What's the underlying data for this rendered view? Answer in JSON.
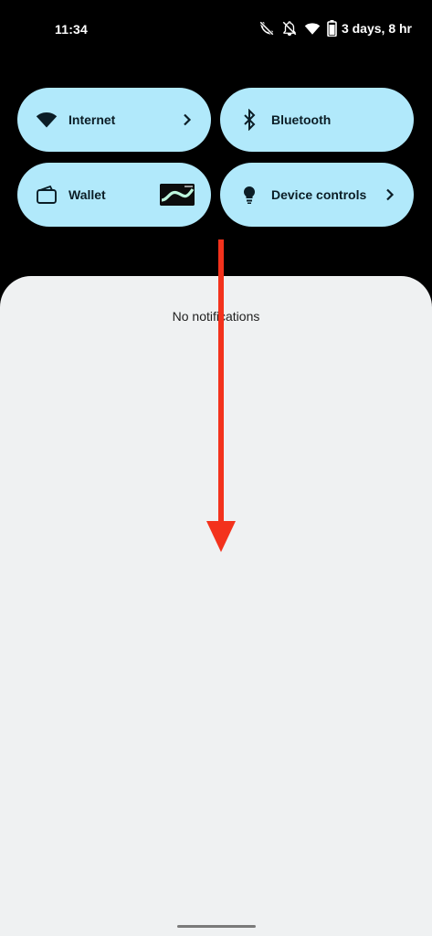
{
  "status_bar": {
    "time": "11:34",
    "battery_text": "3 days, 8 hr",
    "icons": [
      "no-calls-icon",
      "do-not-disturb-icon",
      "wifi-icon",
      "battery-icon"
    ]
  },
  "quick_settings": {
    "tiles": [
      {
        "label": "Internet",
        "icon": "wifi-icon",
        "has_chevron": true
      },
      {
        "label": "Bluetooth",
        "icon": "bluetooth-icon",
        "has_chevron": false
      },
      {
        "label": "Wallet",
        "icon": "wallet-icon",
        "has_card": true
      },
      {
        "label": "Device controls",
        "icon": "lightbulb-icon",
        "has_chevron": true
      }
    ]
  },
  "notifications": {
    "empty_text": "No notifications"
  },
  "colors": {
    "tile_background": "#b1e9fb",
    "shade_background": "#eff1f2",
    "arrow": "#f3321c",
    "background": "#000000"
  }
}
